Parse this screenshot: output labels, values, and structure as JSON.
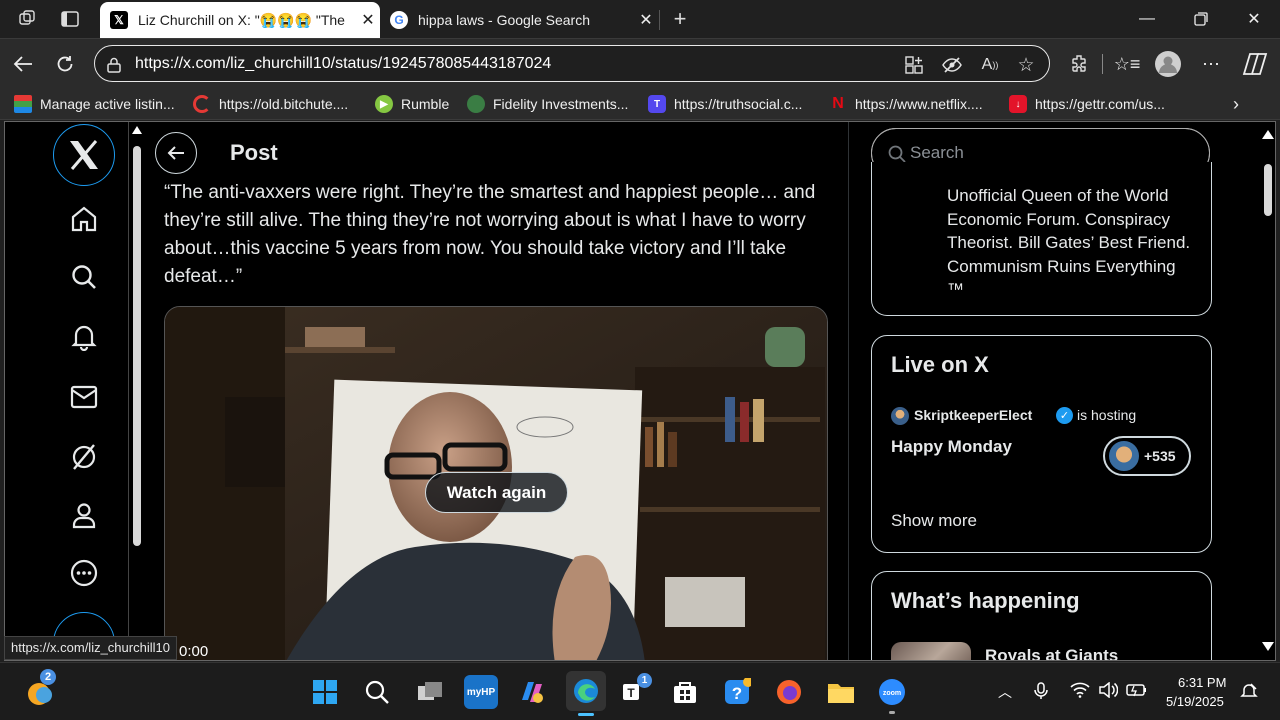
{
  "browser": {
    "tabs": [
      {
        "title": "Liz Churchill on X: \"😭😭😭 \"The",
        "active": true
      },
      {
        "title": "hippa laws - Google Search",
        "active": false
      }
    ],
    "url": "https://x.com/liz_churchill10/status/1924578085443187024",
    "bookmarks": [
      "Manage active listin...",
      "https://old.bitchute....",
      "Rumble",
      "Fidelity Investments...",
      "https://truthsocial.c...",
      "https://www.netflix....",
      "https://gettr.com/us..."
    ],
    "status_link": "https://x.com/liz_churchill10"
  },
  "post": {
    "header": "Post",
    "text": "“The anti-vaxxers were right. They’re the smartest and happiest people… and they’re still alive. The thing they’re not worrying about is what I have to worry about…this vaccine 5 years from now. You should take victory and I’ll take defeat…”",
    "video_button": "Watch again",
    "video_time": "0:00"
  },
  "sidebar": {
    "search_placeholder": "Search",
    "profile_bio": "Unofficial Queen of the World Economic Forum. Conspiracy Theorist. Bill Gates’ Best Friend. Communism Ruins Everything ™",
    "live": {
      "heading": "Live on X",
      "host": "SkriptkeeperElect",
      "hosting": "is hosting",
      "title": "Happy Monday",
      "listeners": "+535",
      "show_more": "Show more"
    },
    "happening": {
      "heading": "What’s happening",
      "item": "Royals at Giants"
    }
  },
  "taskbar": {
    "weather_badge": "2",
    "teams_badge": "1",
    "time": "6:31 PM",
    "date": "5/19/2025"
  }
}
